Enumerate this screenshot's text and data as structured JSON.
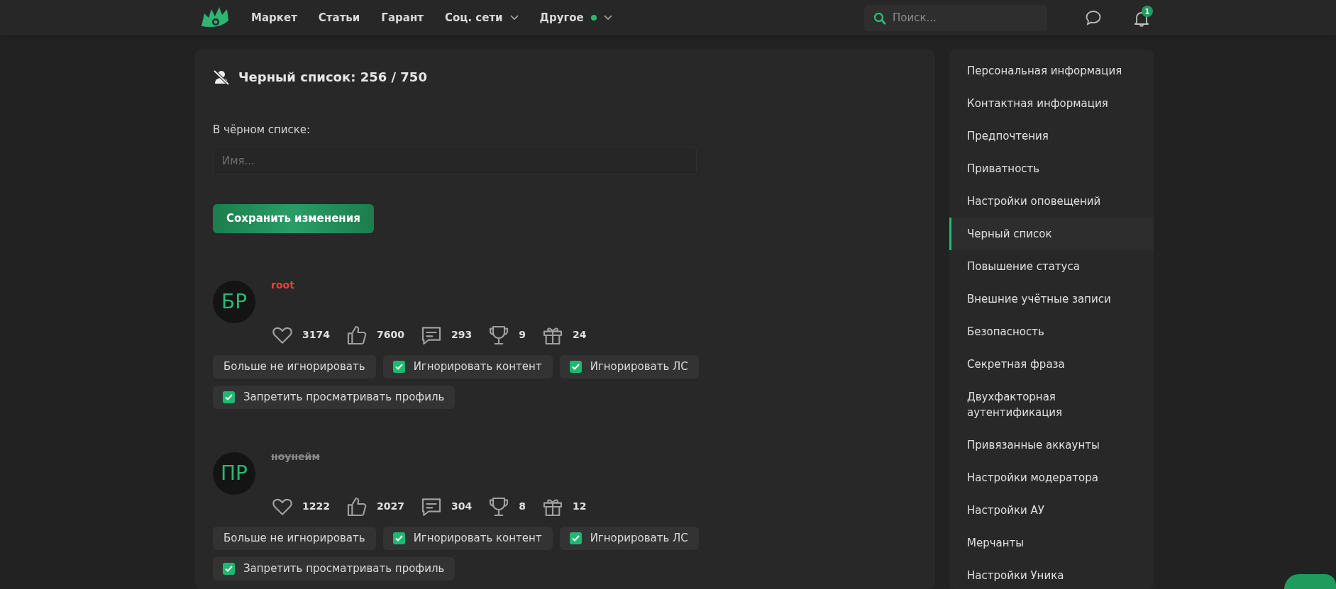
{
  "header": {
    "nav": [
      {
        "label": "Маркет",
        "dropdown": false,
        "dot": false
      },
      {
        "label": "Статьи",
        "dropdown": false,
        "dot": false
      },
      {
        "label": "Гарант",
        "dropdown": false,
        "dot": false
      },
      {
        "label": "Соц. сети",
        "dropdown": true,
        "dot": false
      },
      {
        "label": "Другое",
        "dropdown": true,
        "dot": true
      }
    ],
    "search": {
      "placeholder": "Поиск..."
    },
    "notifications": {
      "count": "1"
    }
  },
  "panel": {
    "title": "Черный список: 256 / 750",
    "field_label": "В чёрном списке:",
    "name_field": {
      "placeholder": "Имя..."
    },
    "save_button": "Сохранить изменения",
    "users": [
      {
        "avatar": "БР",
        "name": "root",
        "kind": "highlighted",
        "stats": [
          {
            "kind": "likes",
            "value": "3174"
          },
          {
            "kind": "thumbs",
            "value": "7600"
          },
          {
            "kind": "messages",
            "value": "293"
          },
          {
            "kind": "trophies",
            "value": "9"
          },
          {
            "kind": "gifts",
            "value": "24"
          }
        ],
        "options": [
          {
            "kind": "button",
            "label": "Больше не игнорировать"
          },
          {
            "kind": "checkbox",
            "label": "Игнорировать контент",
            "checked": true
          },
          {
            "kind": "checkbox",
            "label": "Игнорировать ЛС",
            "checked": true
          },
          {
            "kind": "checkbox",
            "label": "Запретить просматривать профиль",
            "checked": true
          }
        ]
      },
      {
        "avatar": "ПР",
        "name": "ноунейм",
        "kind": "struck",
        "stats": [
          {
            "kind": "likes",
            "value": "1222"
          },
          {
            "kind": "thumbs",
            "value": "2027"
          },
          {
            "kind": "messages",
            "value": "304"
          },
          {
            "kind": "trophies",
            "value": "8"
          },
          {
            "kind": "gifts",
            "value": "12"
          }
        ],
        "options": [
          {
            "kind": "button",
            "label": "Больше не игнорировать"
          },
          {
            "kind": "checkbox",
            "label": "Игнорировать контент",
            "checked": true
          },
          {
            "kind": "checkbox",
            "label": "Игнорировать ЛС",
            "checked": true
          },
          {
            "kind": "checkbox",
            "label": "Запретить просматривать профиль",
            "checked": true
          }
        ]
      }
    ]
  },
  "sidebar": {
    "items": [
      {
        "label": "Персональная информация",
        "selected": false
      },
      {
        "label": "Контактная информация",
        "selected": false
      },
      {
        "label": "Предпочтения",
        "selected": false
      },
      {
        "label": "Приватность",
        "selected": false
      },
      {
        "label": "Настройки оповещений",
        "selected": false
      },
      {
        "label": "Черный список",
        "selected": true
      },
      {
        "label": "Повышение статуса",
        "selected": false
      },
      {
        "label": "Внешние учётные записи",
        "selected": false
      },
      {
        "label": "Безопасность",
        "selected": false
      },
      {
        "label": "Секретная фраза",
        "selected": false
      },
      {
        "label": "Двухфакторная аутентификация",
        "selected": false
      },
      {
        "label": "Привязанные аккаунты",
        "selected": false
      },
      {
        "label": "Настройки модератора",
        "selected": false
      },
      {
        "label": "Настройки АУ",
        "selected": false
      },
      {
        "label": "Мерчанты",
        "selected": false
      },
      {
        "label": "Настройки Уника",
        "selected": false
      }
    ]
  }
}
